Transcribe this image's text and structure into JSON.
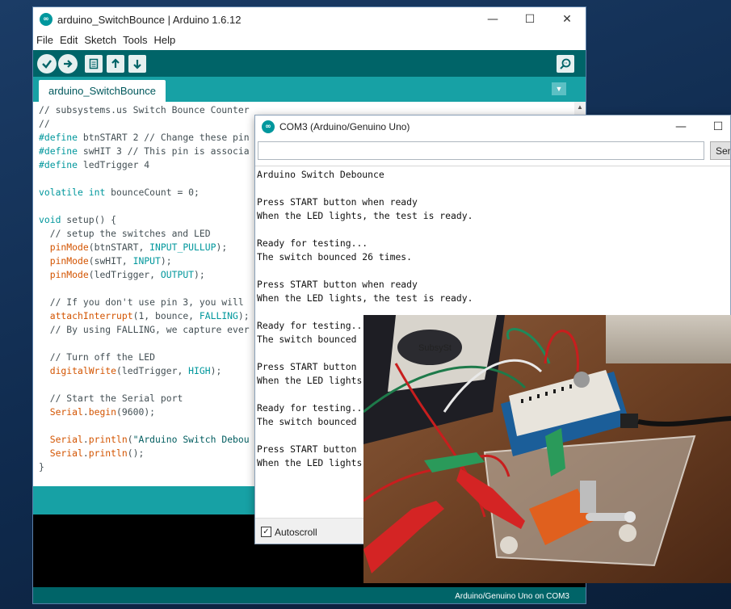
{
  "ide": {
    "title": "arduino_SwitchBounce | Arduino 1.6.12",
    "menu": [
      "File",
      "Edit",
      "Sketch",
      "Tools",
      "Help"
    ],
    "tab": "arduino_SwitchBounce",
    "status": "Arduino/Genuino Uno on COM3",
    "code": [
      [
        {
          "t": "// subsystems.us Switch Bounce Counter",
          "c": "com"
        }
      ],
      [
        {
          "t": "//",
          "c": "com"
        }
      ],
      [
        {
          "t": "#define",
          "c": "kw"
        },
        {
          "t": " btnSTART 2 // Change these pin",
          "c": "com"
        }
      ],
      [
        {
          "t": "#define",
          "c": "kw"
        },
        {
          "t": " swHIT 3 // This pin is associa",
          "c": "com"
        }
      ],
      [
        {
          "t": "#define",
          "c": "kw"
        },
        {
          "t": " ledTrigger 4",
          "c": "com"
        }
      ],
      [],
      [
        {
          "t": "volatile",
          "c": "kw"
        },
        {
          "t": " ",
          "c": "com"
        },
        {
          "t": "int",
          "c": "kw"
        },
        {
          "t": " bounceCount = 0;",
          "c": "com"
        }
      ],
      [],
      [
        {
          "t": "void",
          "c": "kw"
        },
        {
          "t": " ",
          "c": "com"
        },
        {
          "t": "setup",
          "c": "com"
        },
        {
          "t": "() {",
          "c": "com"
        }
      ],
      [
        {
          "t": "  // setup the switches and LED",
          "c": "com"
        }
      ],
      [
        {
          "t": "  ",
          "c": "com"
        },
        {
          "t": "pinMode",
          "c": "fn"
        },
        {
          "t": "(btnSTART, ",
          "c": "com"
        },
        {
          "t": "INPUT_PULLUP",
          "c": "const"
        },
        {
          "t": ");",
          "c": "com"
        }
      ],
      [
        {
          "t": "  ",
          "c": "com"
        },
        {
          "t": "pinMode",
          "c": "fn"
        },
        {
          "t": "(swHIT, ",
          "c": "com"
        },
        {
          "t": "INPUT",
          "c": "const"
        },
        {
          "t": ");",
          "c": "com"
        }
      ],
      [
        {
          "t": "  ",
          "c": "com"
        },
        {
          "t": "pinMode",
          "c": "fn"
        },
        {
          "t": "(ledTrigger, ",
          "c": "com"
        },
        {
          "t": "OUTPUT",
          "c": "const"
        },
        {
          "t": ");",
          "c": "com"
        }
      ],
      [],
      [
        {
          "t": "  // If you don't use pin 3, you will",
          "c": "com"
        }
      ],
      [
        {
          "t": "  ",
          "c": "com"
        },
        {
          "t": "attachInterrupt",
          "c": "fn"
        },
        {
          "t": "(1, bounce, ",
          "c": "com"
        },
        {
          "t": "FALLING",
          "c": "const"
        },
        {
          "t": ");",
          "c": "com"
        }
      ],
      [
        {
          "t": "  // By using FALLING, we capture ever",
          "c": "com"
        }
      ],
      [],
      [
        {
          "t": "  // Turn off the LED",
          "c": "com"
        }
      ],
      [
        {
          "t": "  ",
          "c": "com"
        },
        {
          "t": "digitalWrite",
          "c": "fn"
        },
        {
          "t": "(ledTrigger, ",
          "c": "com"
        },
        {
          "t": "HIGH",
          "c": "const"
        },
        {
          "t": ");",
          "c": "com"
        }
      ],
      [],
      [
        {
          "t": "  // Start the Serial port",
          "c": "com"
        }
      ],
      [
        {
          "t": "  ",
          "c": "com"
        },
        {
          "t": "Serial",
          "c": "fn"
        },
        {
          "t": ".",
          "c": "com"
        },
        {
          "t": "begin",
          "c": "fn"
        },
        {
          "t": "(9600);",
          "c": "com"
        }
      ],
      [],
      [
        {
          "t": "  ",
          "c": "com"
        },
        {
          "t": "Serial",
          "c": "fn"
        },
        {
          "t": ".",
          "c": "com"
        },
        {
          "t": "println",
          "c": "fn"
        },
        {
          "t": "(",
          "c": "com"
        },
        {
          "t": "\"Arduino Switch Debou",
          "c": "str"
        }
      ],
      [
        {
          "t": "  ",
          "c": "com"
        },
        {
          "t": "Serial",
          "c": "fn"
        },
        {
          "t": ".",
          "c": "com"
        },
        {
          "t": "println",
          "c": "fn"
        },
        {
          "t": "();",
          "c": "com"
        }
      ],
      [
        {
          "t": "}",
          "c": "com"
        }
      ]
    ]
  },
  "serial": {
    "title": "COM3 (Arduino/Genuino Uno)",
    "send_value": "",
    "send_label": "Send",
    "output": [
      "Arduino Switch Debounce",
      "",
      "Press START button when ready",
      "When the LED lights, the test is ready.",
      "",
      "Ready for testing...",
      "The switch bounced 26 times.",
      "",
      "Press START button when ready",
      "When the LED lights, the test is ready.",
      "",
      "Ready for testing...",
      "The switch bounced",
      "",
      "Press START button",
      "When the LED lights",
      "",
      "Ready for testing...",
      "The switch bounced",
      "",
      "Press START button",
      "When the LED lights"
    ],
    "autoscroll_label": "Autoscroll",
    "autoscroll_checked": true
  },
  "photo": {
    "board_text": "SubsySt"
  },
  "colors": {
    "teal_dark": "#006468",
    "teal": "#17a1a5",
    "keyword": "#00979c",
    "function": "#d35400"
  }
}
